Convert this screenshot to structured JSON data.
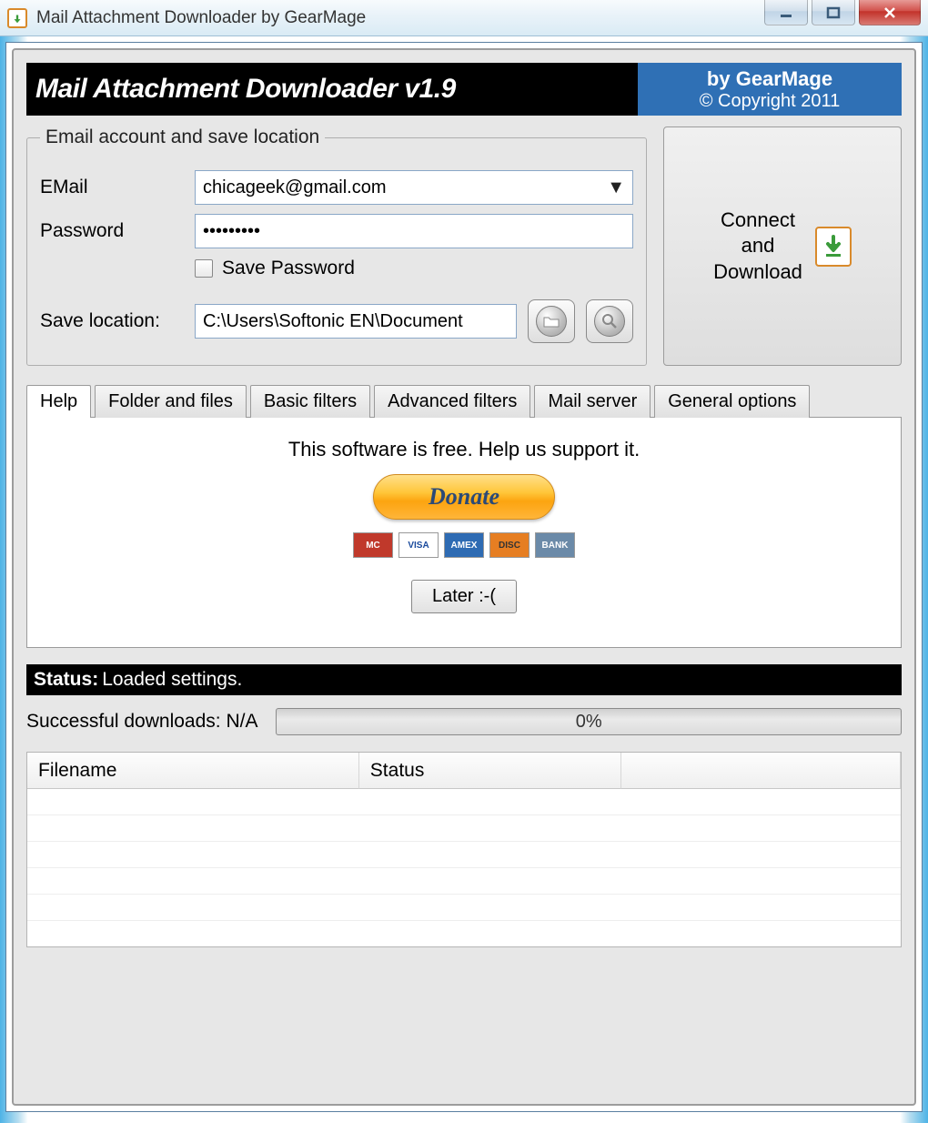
{
  "window": {
    "title": "Mail Attachment Downloader by GearMage"
  },
  "banner": {
    "title": "Mail Attachment Downloader v1.9",
    "brand_prefix": "by",
    "brand": "GearMage",
    "copyright": "© Copyright 2011"
  },
  "account": {
    "legend": "Email account and save location",
    "email_label": "EMail",
    "email_value": "chicageek@gmail.com",
    "password_label": "Password",
    "password_value": "•••••••••",
    "save_password_label": "Save Password",
    "save_password_checked": false,
    "save_location_label": "Save location:",
    "save_location_value": "C:\\Users\\Softonic EN\\Document"
  },
  "connect": {
    "label": "Connect and Download"
  },
  "tabs": {
    "items": [
      {
        "label": "Help",
        "active": true
      },
      {
        "label": "Folder and files",
        "active": false
      },
      {
        "label": "Basic filters",
        "active": false
      },
      {
        "label": "Advanced filters",
        "active": false
      },
      {
        "label": "Mail server",
        "active": false
      },
      {
        "label": "General options",
        "active": false
      }
    ]
  },
  "help_pane": {
    "message": "This software is free. Help us support it.",
    "donate_label": "Donate",
    "later_label": "Later :-(",
    "cards": [
      "MC",
      "VISA",
      "AMEX",
      "DISC",
      "BANK"
    ],
    "card_colors": [
      "#c0392b",
      "#ffffff",
      "#2e6bb3",
      "#e67e22",
      "#6b8aa8"
    ],
    "card_text_colors": [
      "#fff",
      "#1a4a9c",
      "#fff",
      "#333",
      "#fff"
    ]
  },
  "status": {
    "label": "Status",
    "text": "Loaded settings."
  },
  "downloads": {
    "label": "Successful downloads:",
    "value": "N/A",
    "progress_pct": "0%"
  },
  "table": {
    "columns": [
      "Filename",
      "Status",
      ""
    ]
  }
}
